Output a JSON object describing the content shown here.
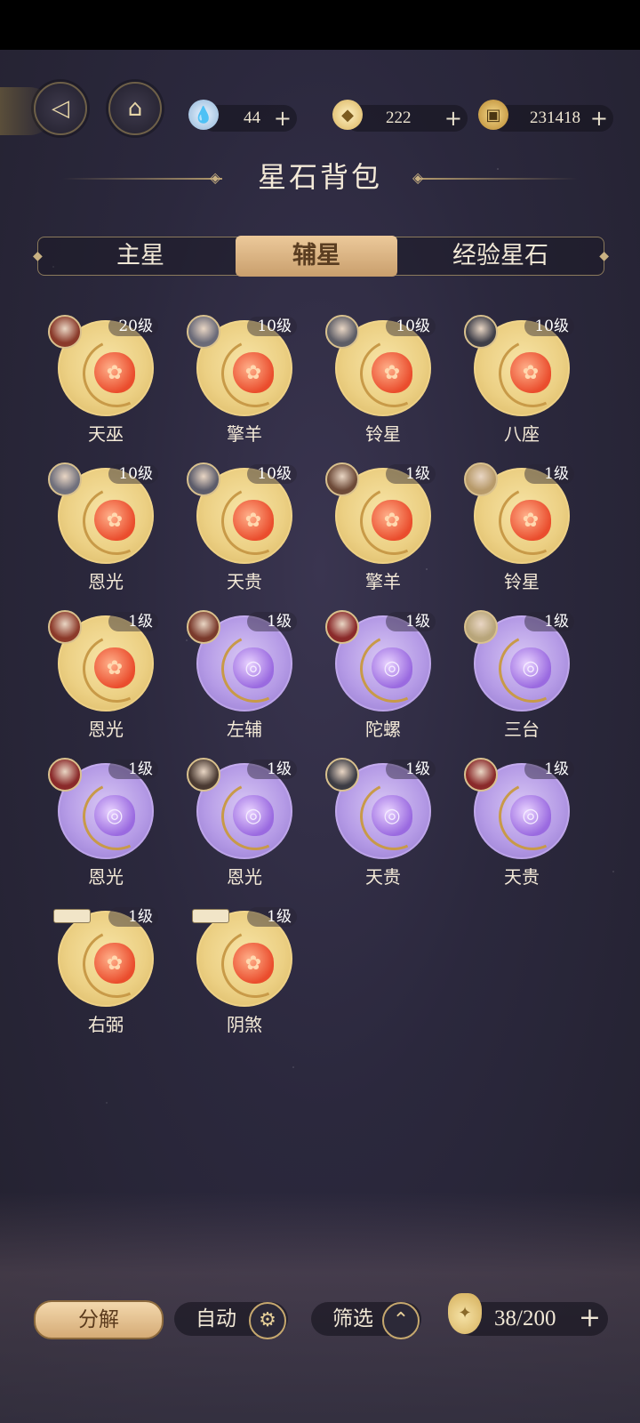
{
  "header": {
    "back_icon": "back-arrow-icon",
    "home_icon": "pavilion-icon",
    "currencies": [
      {
        "icon": "water-drop-icon",
        "value": "44",
        "plus": "+"
      },
      {
        "icon": "money-bag-icon",
        "value": "222",
        "plus": "+"
      },
      {
        "icon": "copper-coin-icon",
        "value": "231418",
        "plus": "+"
      }
    ]
  },
  "title": "星石背包",
  "tabs": [
    {
      "label": "主星",
      "active": false
    },
    {
      "label": "辅星",
      "active": true
    },
    {
      "label": "经验星石",
      "active": false
    }
  ],
  "stones": [
    {
      "name": "天巫",
      "level": "20级",
      "color": "gold"
    },
    {
      "name": "擎羊",
      "level": "10级",
      "color": "gold"
    },
    {
      "name": "铃星",
      "level": "10级",
      "color": "gold"
    },
    {
      "name": "八座",
      "level": "10级",
      "color": "gold"
    },
    {
      "name": "恩光",
      "level": "10级",
      "color": "gold"
    },
    {
      "name": "天贵",
      "level": "10级",
      "color": "gold"
    },
    {
      "name": "擎羊",
      "level": "1级",
      "color": "gold"
    },
    {
      "name": "铃星",
      "level": "1级",
      "color": "gold"
    },
    {
      "name": "恩光",
      "level": "1级",
      "color": "gold"
    },
    {
      "name": "左辅",
      "level": "1级",
      "color": "purple"
    },
    {
      "name": "陀螺",
      "level": "1级",
      "color": "purple"
    },
    {
      "name": "三台",
      "level": "1级",
      "color": "purple"
    },
    {
      "name": "恩光",
      "level": "1级",
      "color": "purple"
    },
    {
      "name": "恩光",
      "level": "1级",
      "color": "purple"
    },
    {
      "name": "天贵",
      "level": "1级",
      "color": "purple"
    },
    {
      "name": "天贵",
      "level": "1级",
      "color": "purple"
    },
    {
      "name": "右弼",
      "level": "1级",
      "color": "gold"
    },
    {
      "name": "阴煞",
      "level": "1级",
      "color": "gold"
    }
  ],
  "bottom": {
    "decompose": "分解",
    "auto": "自动",
    "filter": "筛选",
    "capacity": "38/200",
    "plus": "+"
  },
  "colors": {
    "gold": "#ecd084",
    "purple": "#b59be6",
    "accent": "#d5ab76"
  }
}
